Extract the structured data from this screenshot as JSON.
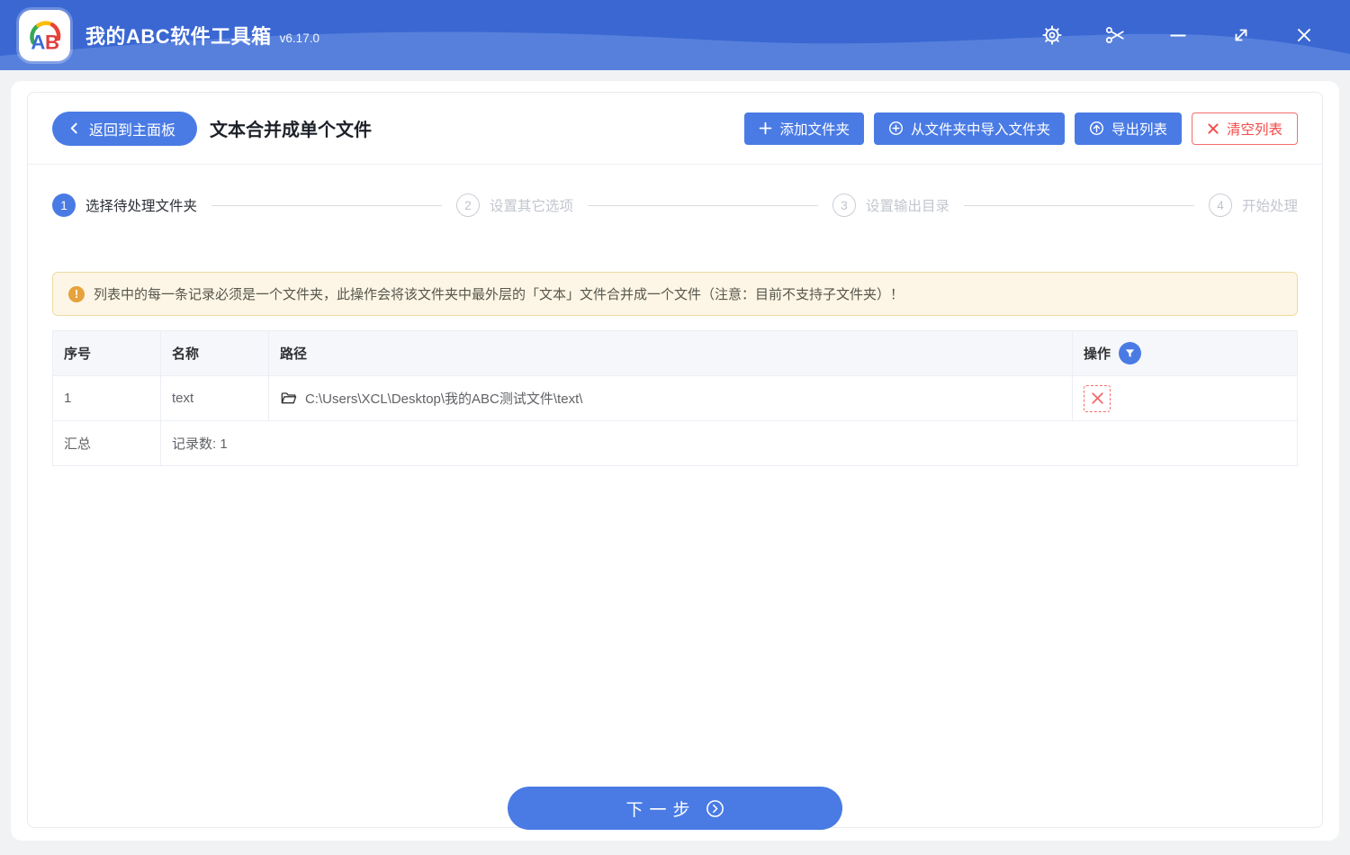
{
  "app": {
    "logo": "AB",
    "title": "我的ABC软件工具箱",
    "version": "v6.17.0"
  },
  "titlebar_icons": [
    "settings-icon",
    "scissors-icon",
    "minimize-icon",
    "maximize-icon",
    "close-icon"
  ],
  "header": {
    "back": "返回到主面板",
    "title": "文本合并成单个文件",
    "add": "添加文件夹",
    "import": "从文件夹中导入文件夹",
    "export": "导出列表",
    "clear": "清空列表"
  },
  "steps": [
    {
      "num": "1",
      "label": "选择待处理文件夹",
      "active": true
    },
    {
      "num": "2",
      "label": "设置其它选项",
      "active": false
    },
    {
      "num": "3",
      "label": "设置输出目录",
      "active": false
    },
    {
      "num": "4",
      "label": "开始处理",
      "active": false
    }
  ],
  "notice": {
    "text": "列表中的每一条记录必须是一个文件夹，此操作会将该文件夹中最外层的「文本」文件合并成一个文件（注意：目前不支持子文件夹）！"
  },
  "table": {
    "headers": [
      "序号",
      "名称",
      "路径",
      "操作"
    ],
    "rows": [
      {
        "index": "1",
        "name": "text",
        "path": "C:\\Users\\XCL\\Desktop\\我的ABC测试文件\\text\\"
      }
    ],
    "summary_label": "汇总",
    "summary_value": "记录数: 1"
  },
  "footer": {
    "next": "下一步"
  },
  "colors": {
    "primary": "#4A7BE5",
    "titlebar": "#3A67D2",
    "danger": "#F56C6C",
    "warning": "#E6A23C"
  }
}
